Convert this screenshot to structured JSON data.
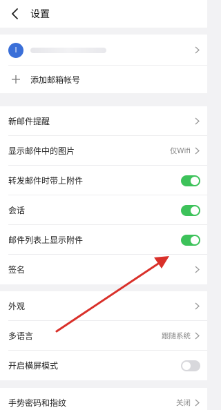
{
  "header": {
    "title": "设置",
    "back_icon": "chevron-left-icon"
  },
  "account": {
    "avatar_letter": "l",
    "avatar_color": "#3a6fd8",
    "add_label": "添加邮箱帐号"
  },
  "settings_group1": {
    "new_mail_alert": "新邮件提醒",
    "show_images": "显示邮件中的图片",
    "show_images_value": "仅Wifi",
    "forward_attachments": "转发邮件时带上附件",
    "forward_attachments_on": true,
    "conversation": "会话",
    "conversation_on": true,
    "list_attachments": "邮件列表上显示附件",
    "list_attachments_on": true,
    "signature": "签名"
  },
  "settings_group2": {
    "appearance": "外观",
    "language": "多语言",
    "language_value": "跟随系统",
    "landscape": "开启横屏模式",
    "landscape_on": false
  },
  "settings_group3": {
    "gesture_password": "手势密码和指纹",
    "gesture_password_value": "关闭"
  },
  "colors": {
    "accent_toggle": "#3dc25a",
    "annotation_arrow": "#d9302a"
  }
}
